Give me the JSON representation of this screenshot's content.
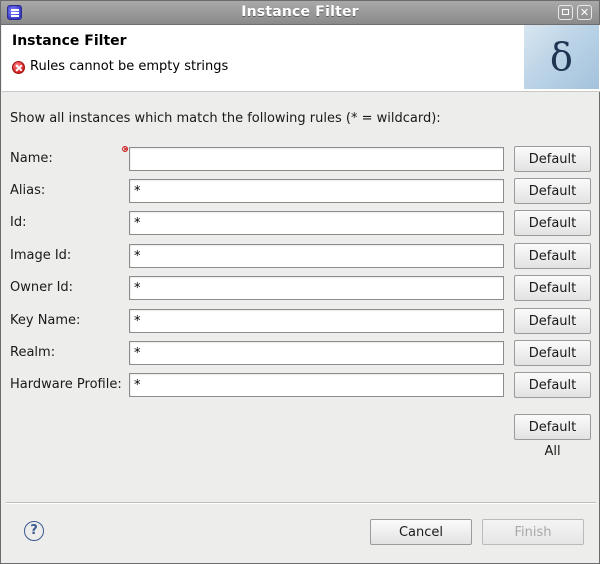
{
  "window": {
    "title": "Instance Filter"
  },
  "header": {
    "title": "Instance Filter",
    "error_message": "Rules cannot be empty strings",
    "banner_glyph": "δ"
  },
  "form": {
    "intro": "Show all instances which match the following rules (* = wildcard):",
    "default_label": "Default",
    "default_all_label": "Default All",
    "rows": [
      {
        "label": "Name:",
        "value": ""
      },
      {
        "label": "Alias:",
        "value": "*"
      },
      {
        "label": "Id:",
        "value": "*"
      },
      {
        "label": "Image Id:",
        "value": "*"
      },
      {
        "label": "Owner Id:",
        "value": "*"
      },
      {
        "label": "Key Name:",
        "value": "*"
      },
      {
        "label": "Realm:",
        "value": "*"
      },
      {
        "label": "Hardware Profile:",
        "value": "*"
      }
    ]
  },
  "footer": {
    "help_glyph": "?",
    "cancel_label": "Cancel",
    "finish_label": "Finish"
  },
  "colors": {
    "titlebar": "#9a9a9a",
    "error": "#d01f1f",
    "help": "#3b5b8f"
  },
  "icons": {
    "app": "eclipse-app-icon",
    "error": "error-icon",
    "help": "help-icon"
  }
}
